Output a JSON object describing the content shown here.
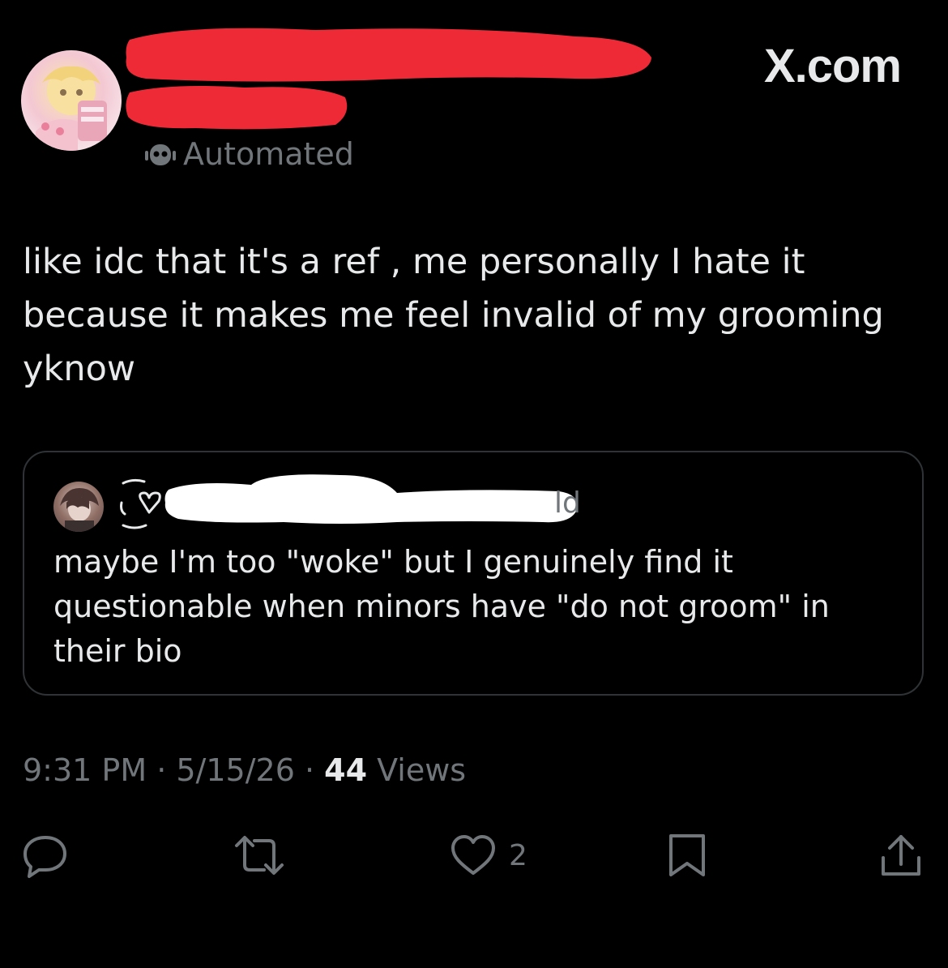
{
  "header": {
    "site_label": "X.com",
    "automated_label": "Automated"
  },
  "tweet": {
    "text": "like idc that it's a ref , me personally I hate it\nbecause it makes me feel invalid of my grooming\nyknow"
  },
  "quote": {
    "name_suffix": "ld",
    "text": "maybe I'm too \"woke\" but I genuinely find it\nquestionable when minors have \"do not groom\" in\ntheir bio"
  },
  "meta": {
    "time": "9:31 PM",
    "date": "5/15/26",
    "separator": " · ",
    "views_count": "44",
    "views_label": " Views"
  },
  "actions": {
    "like_count": "2"
  },
  "colors": {
    "background": "#000000",
    "text_primary": "#e7e9ea",
    "text_secondary": "#71767b",
    "border": "#2f3336",
    "redaction_red": "#ef2a37",
    "redaction_white": "#ffffff"
  },
  "icons": {
    "bot": "bot-icon",
    "reply": "reply-icon",
    "repost": "repost-icon",
    "like": "heart-icon",
    "bookmark": "bookmark-icon",
    "share": "share-icon"
  }
}
